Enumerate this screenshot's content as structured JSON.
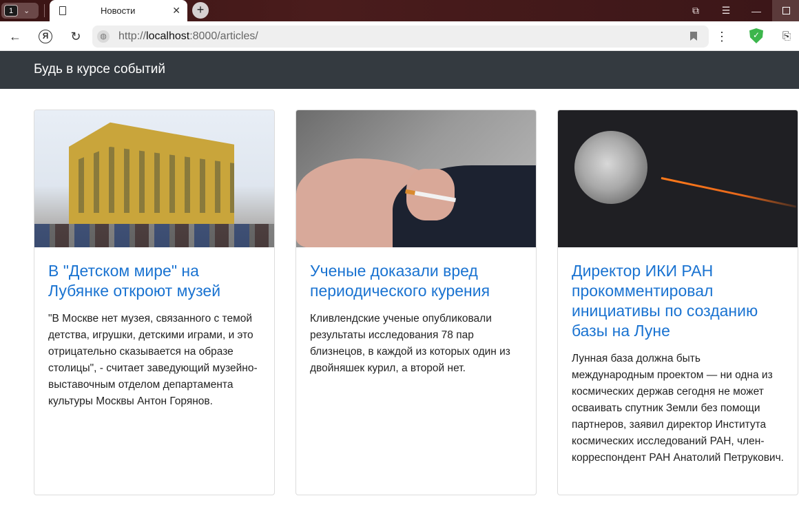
{
  "browser": {
    "tab_count": "1",
    "tab_title": "Новости",
    "url_prefix": "http://",
    "url_host": "localhost",
    "url_rest": ":8000/articles/"
  },
  "navbar": {
    "brand": "Будь в курсе событий"
  },
  "articles": [
    {
      "title": "В \"Детском мире\" на Лубянке откроют музей",
      "text": "\"В Москве нет музея, связанного с темой детства, игрушки, детскими играми, и это отрицательно сказывается на образе столицы\", - считает заведующий музейно-выставочным отделом департамента культуры Москвы Антон Горянов.",
      "image_alt": "Здание Детского мира"
    },
    {
      "title": "Ученые доказали вред периодического курения",
      "text": "Кливлендские ученые опубликовали результаты исследования 78 пар близнецов, в каждой из которых один из двойняшек курил, а второй нет.",
      "image_alt": "Курящий человек"
    },
    {
      "title": "Директор ИКИ РАН прокомментировал инициативы по созданию базы на Луне",
      "text": "Лунная база должна быть международным проектом — ни одна из космических держав сегодня не может осваивать спутник Земли без помощи партнеров, заявил директор Института космических исследований РАН, член-корреспондент РАН Анатолий Петрукович.",
      "image_alt": "Луна и ракета"
    }
  ],
  "colors": {
    "navbar_bg": "#343a40",
    "link": "#1a73d1",
    "tabbar": "#3a1414"
  }
}
